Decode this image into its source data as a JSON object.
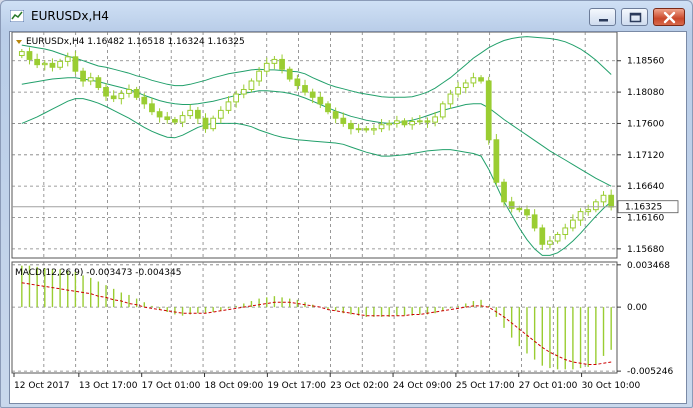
{
  "window": {
    "title": "EURUSDx,H4",
    "controls": [
      "minimize",
      "maximize",
      "close"
    ]
  },
  "chart_header": {
    "text": "EURUSDx,H4  1.16482 1.16518 1.16324 1.16325"
  },
  "macd_header": {
    "text": "MACD(12,26,9) -0.003473 -0.004345"
  },
  "colors": {
    "candle": "#9acd32",
    "bands": "#22a06b",
    "grid": "#7f7f7f",
    "macd_signal": "#cc0000",
    "price_label_bg": "#ffffff",
    "price_line": "#a0a0a0"
  },
  "chart_data": [
    {
      "type": "candlestick",
      "title": "EURUSDx,H4  1.16482 1.16518 1.16324 1.16325",
      "price_ticks": [
        "1.18560",
        "1.18080",
        "1.17600",
        "1.17120",
        "1.16640",
        "1.16160",
        "1.15680"
      ],
      "price_tick_values": [
        1.1856,
        1.1808,
        1.176,
        1.1712,
        1.1664,
        1.1616,
        1.1568
      ],
      "ylim": [
        1.1554,
        1.19
      ],
      "current_price": "1.16325",
      "current_price_value": 1.16325,
      "time_labels": [
        "12 Oct 2017",
        "13 Oct 17:00",
        "17 Oct 01:00",
        "18 Oct 09:00",
        "19 Oct 17:00",
        "23 Oct 02:00",
        "24 Oct 09:00",
        "25 Oct 17:00",
        "27 Oct 01:00",
        "30 Oct 10:00"
      ],
      "closes": [
        1.187,
        1.1858,
        1.185,
        1.1852,
        1.1846,
        1.1855,
        1.1862,
        1.184,
        1.1825,
        1.183,
        1.1815,
        1.1802,
        1.1798,
        1.1806,
        1.1812,
        1.18,
        1.179,
        1.1778,
        1.177,
        1.1766,
        1.1762,
        1.1772,
        1.178,
        1.1768,
        1.1752,
        1.1768,
        1.178,
        1.1793,
        1.1805,
        1.1812,
        1.1825,
        1.184,
        1.1852,
        1.1858,
        1.1843,
        1.1828,
        1.1818,
        1.1808,
        1.18,
        1.179,
        1.1778,
        1.1768,
        1.176,
        1.1752,
        1.1752,
        1.175,
        1.1752,
        1.1758,
        1.176,
        1.1764,
        1.1758,
        1.1763,
        1.1764,
        1.1762,
        1.177,
        1.179,
        1.1805,
        1.1815,
        1.1822,
        1.183,
        1.1825,
        1.1735,
        1.167,
        1.164,
        1.163,
        1.1628,
        1.162,
        1.16,
        1.1575,
        1.158,
        1.159,
        1.16,
        1.1612,
        1.1625,
        1.1628,
        1.164,
        1.165,
        1.1632
      ],
      "bb_upper": [
        1.188,
        1.1878,
        1.1876,
        1.1874,
        1.1871,
        1.1867,
        1.1863,
        1.186,
        1.1856,
        1.1852,
        1.1848,
        1.1846,
        1.1843,
        1.184,
        1.1837,
        1.1833,
        1.183,
        1.1826,
        1.1823,
        1.182,
        1.1818,
        1.1818,
        1.182,
        1.1823,
        1.1826,
        1.183,
        1.1833,
        1.1836,
        1.1838,
        1.184,
        1.1842,
        1.1843,
        1.1842,
        1.1842,
        1.1841,
        1.184,
        1.1839,
        1.1836,
        1.183,
        1.1825,
        1.182,
        1.1816,
        1.1813,
        1.181,
        1.1807,
        1.1805,
        1.1803,
        1.1801,
        1.18,
        1.18,
        1.18,
        1.1801,
        1.1804,
        1.1808,
        1.1814,
        1.1822,
        1.183,
        1.184,
        1.185,
        1.186,
        1.1868,
        1.1876,
        1.1882,
        1.1887,
        1.189,
        1.1892,
        1.1893,
        1.1892,
        1.1891,
        1.189,
        1.1888,
        1.1885,
        1.188,
        1.1874,
        1.1866,
        1.1857,
        1.1846,
        1.1835
      ],
      "bb_middle": [
        1.182,
        1.1822,
        1.1824,
        1.1826,
        1.1828,
        1.1829,
        1.183,
        1.183,
        1.1828,
        1.1826,
        1.1824,
        1.1821,
        1.1818,
        1.1815,
        1.1812,
        1.1808,
        1.1803,
        1.1799,
        1.1795,
        1.1792,
        1.179,
        1.1789,
        1.1789,
        1.179,
        1.1792,
        1.1794,
        1.1797,
        1.18,
        1.1803,
        1.1806,
        1.1808,
        1.181,
        1.181,
        1.1809,
        1.1808,
        1.1806,
        1.1803,
        1.1799,
        1.1794,
        1.1789,
        1.1784,
        1.1779,
        1.1775,
        1.1771,
        1.1768,
        1.1765,
        1.1763,
        1.1761,
        1.176,
        1.1761,
        1.1763,
        1.1765,
        1.1768,
        1.1772,
        1.1776,
        1.178,
        1.1783,
        1.1786,
        1.1789,
        1.179,
        1.179,
        1.1784,
        1.1775,
        1.1766,
        1.1758,
        1.175,
        1.1742,
        1.1734,
        1.1726,
        1.1718,
        1.1711,
        1.1704,
        1.1697,
        1.169,
        1.1683,
        1.1676,
        1.167,
        1.1664
      ],
      "bb_lower": [
        1.176,
        1.1765,
        1.177,
        1.1776,
        1.1782,
        1.1788,
        1.1794,
        1.1798,
        1.1798,
        1.1795,
        1.1791,
        1.1786,
        1.178,
        1.1774,
        1.1768,
        1.1761,
        1.1754,
        1.1748,
        1.1743,
        1.1739,
        1.1738,
        1.1742,
        1.1748,
        1.1754,
        1.1758,
        1.176,
        1.176,
        1.176,
        1.176,
        1.1758,
        1.1755,
        1.175,
        1.1746,
        1.1742,
        1.1739,
        1.1737,
        1.1735,
        1.1734,
        1.1733,
        1.1732,
        1.1731,
        1.173,
        1.1728,
        1.1724,
        1.172,
        1.1716,
        1.1713,
        1.171,
        1.171,
        1.1711,
        1.1712,
        1.1714,
        1.1716,
        1.1718,
        1.1719,
        1.172,
        1.172,
        1.1718,
        1.1716,
        1.1714,
        1.171,
        1.169,
        1.1665,
        1.164,
        1.162,
        1.16,
        1.1582,
        1.1568,
        1.1558,
        1.1558,
        1.1562,
        1.157,
        1.158,
        1.1592,
        1.1605,
        1.1618,
        1.163,
        1.164
      ]
    },
    {
      "type": "bar",
      "title": "MACD(12,26,9) -0.003473 -0.004345",
      "value_ticks": [
        "0.003468",
        "0.00",
        "-0.005246"
      ],
      "value_tick_values": [
        0.003468,
        0.0,
        -0.005246
      ],
      "ylim": [
        -0.0054,
        0.0037
      ],
      "macd": [
        0.0034,
        0.0034,
        0.0033,
        0.0032,
        0.0031,
        0.0031,
        0.003,
        0.0029,
        0.0026,
        0.0024,
        0.0021,
        0.0018,
        0.0015,
        0.0012,
        0.001,
        0.0007,
        0.0004,
        0.0001,
        -0.0002,
        -0.0004,
        -0.0006,
        -0.0007,
        -0.0006,
        -0.0005,
        -0.0005,
        -0.0004,
        -0.0003,
        -0.0001,
        0.0001,
        0.0003,
        0.0005,
        0.0007,
        0.0008,
        0.0009,
        0.0008,
        0.0007,
        0.0006,
        0.0004,
        0.0002,
        0.0,
        -0.0002,
        -0.0003,
        -0.0005,
        -0.0006,
        -0.0007,
        -0.0008,
        -0.0008,
        -0.0008,
        -0.0008,
        -0.0007,
        -0.0007,
        -0.0007,
        -0.0006,
        -0.0006,
        -0.0005,
        -0.0003,
        -0.0001,
        0.0001,
        0.0003,
        0.0005,
        0.0006,
        0.0001,
        -0.0008,
        -0.0017,
        -0.0025,
        -0.0032,
        -0.0038,
        -0.0043,
        -0.0048,
        -0.005,
        -0.0051,
        -0.0051,
        -0.0051,
        -0.005,
        -0.0049,
        -0.0047,
        -0.004,
        -0.0035
      ],
      "signal": [
        0.002,
        0.0019,
        0.0018,
        0.0017,
        0.0016,
        0.0015,
        0.0014,
        0.0013,
        0.0012,
        0.0011,
        0.0009,
        0.0008,
        0.0006,
        0.0005,
        0.0003,
        0.0002,
        0.0,
        -0.0001,
        -0.0002,
        -0.0003,
        -0.0004,
        -0.0005,
        -0.0005,
        -0.0005,
        -0.0005,
        -0.0004,
        -0.0003,
        -0.0002,
        -0.0001,
        0.0,
        0.0001,
        0.0002,
        0.0003,
        0.0004,
        0.0004,
        0.0004,
        0.0003,
        0.0002,
        0.0001,
        0.0,
        -0.0002,
        -0.0003,
        -0.0004,
        -0.0005,
        -0.0006,
        -0.0007,
        -0.0007,
        -0.0007,
        -0.0007,
        -0.0007,
        -0.0007,
        -0.0006,
        -0.0006,
        -0.0005,
        -0.0004,
        -0.0003,
        -0.0002,
        -0.0001,
        0.0,
        0.0001,
        0.0001,
        0.0,
        -0.0004,
        -0.0008,
        -0.0013,
        -0.0018,
        -0.0023,
        -0.0028,
        -0.0033,
        -0.0037,
        -0.004,
        -0.0043,
        -0.0045,
        -0.0046,
        -0.0047,
        -0.0047,
        -0.0046,
        -0.0045
      ]
    }
  ]
}
